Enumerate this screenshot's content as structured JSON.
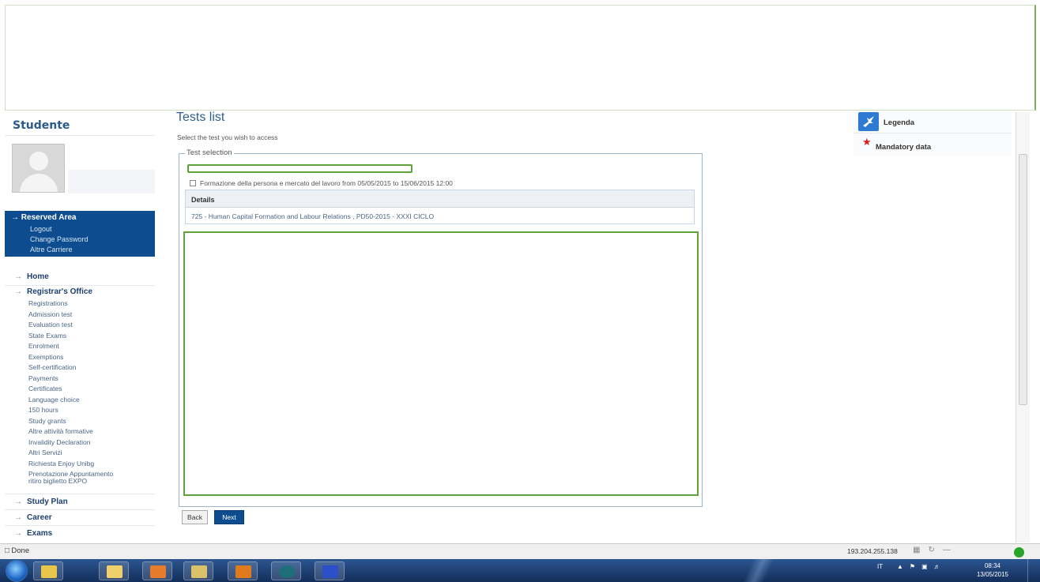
{
  "sidebar": {
    "title": "Studente",
    "reserved_area": {
      "title": "Reserved Area",
      "links": [
        "Logout",
        "Change Password",
        "Altre Carriere"
      ]
    },
    "menu": {
      "home": "Home",
      "registrar": "Registrar's Office",
      "registrar_items": [
        "Registrations",
        "Admission test",
        "Evaluation test",
        "State Exams",
        "Enrolment",
        "Exemptions",
        "Self-certification",
        "Payments",
        "Certificates",
        "Language choice",
        "150 hours",
        "Study grants",
        "Altre attività formative",
        "Invalidity Declaration",
        "Altri Servizi",
        "Richiesta Enjoy Unibg",
        "Prenotazione Appuntamento",
        "ritiro biglietto EXPO"
      ],
      "study_plan": "Study Plan",
      "career": "Career",
      "exams": "Exams"
    }
  },
  "main": {
    "title": "Tests list",
    "subtitle": "Select the test you wish to access",
    "fieldset_legend": "Test selection",
    "test_option": "Formazione della persona e mercato del lavoro from 05/05/2015 to 15/06/2015 12:00",
    "details_header": "Details",
    "details_row": "725 - Human Capital Formation and Labour Relations , PD50-2015 - XXXI CICLO",
    "back_label": "Back",
    "next_label": "Next"
  },
  "legend_panel": {
    "legenda": "Legenda",
    "mandatory": "Mandatory data"
  },
  "statusbar": {
    "status": "Done",
    "ip": "193.204.255.138"
  },
  "taskbar": {
    "lang": "IT",
    "time": "08:34",
    "date": "13/05/2015"
  },
  "colors": {
    "brand_blue": "#0d4d8f",
    "highlight_green": "#5fa23c",
    "mandatory_red": "#d71f1f"
  }
}
